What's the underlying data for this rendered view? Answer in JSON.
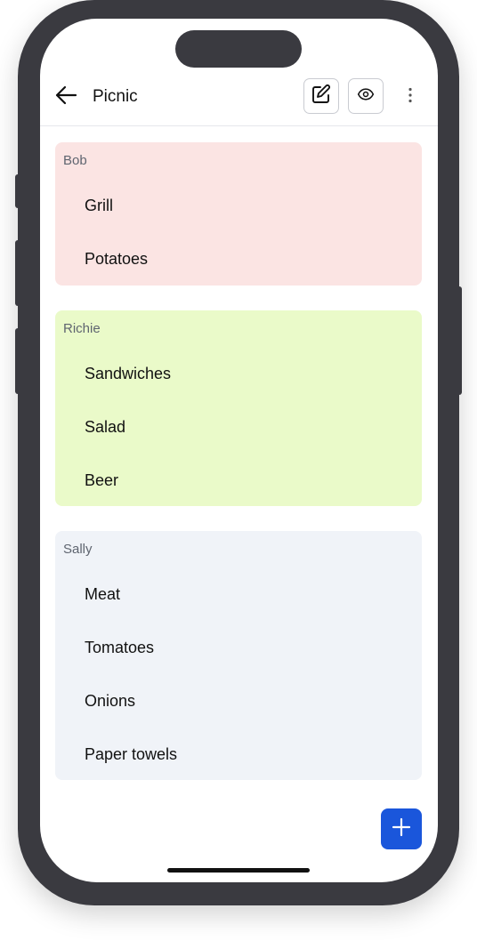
{
  "appbar": {
    "title": "Picnic",
    "back_icon": "arrow-left-icon",
    "edit_icon": "pencil-square-icon",
    "view_icon": "eye-icon",
    "more_icon": "dots-vertical-icon"
  },
  "groups": [
    {
      "name": "Bob",
      "color": "#fbe4e3",
      "items": [
        "Grill",
        "Potatoes"
      ]
    },
    {
      "name": "Richie",
      "color": "#eafac9",
      "items": [
        "Sandwiches",
        "Salad",
        "Beer"
      ]
    },
    {
      "name": "Sally",
      "color": "#f0f3f8",
      "items": [
        "Meat",
        "Tomatoes",
        "Onions",
        "Paper towels"
      ]
    }
  ],
  "fab": {
    "icon": "plus-icon",
    "color": "#1a56db"
  }
}
